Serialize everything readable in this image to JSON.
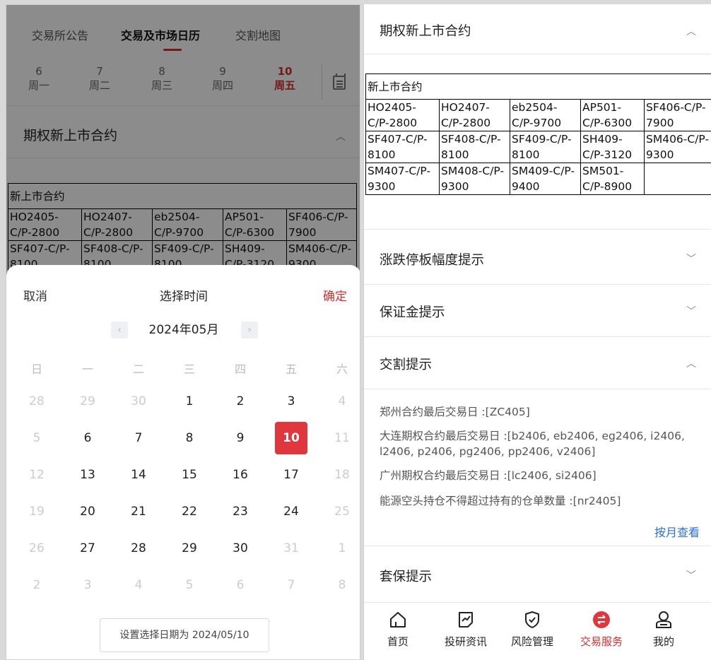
{
  "left": {
    "tabs": [
      "交易所公告",
      "交易及市场日历",
      "交割地图"
    ],
    "active_tab_index": 1,
    "days": [
      {
        "num": "6",
        "week": "周一"
      },
      {
        "num": "7",
        "week": "周二"
      },
      {
        "num": "8",
        "week": "周三"
      },
      {
        "num": "9",
        "week": "周四"
      },
      {
        "num": "10",
        "week": "周五"
      }
    ],
    "active_day_index": 4,
    "section_title": "期权新上市合约",
    "table": {
      "header": "新上市合约",
      "rows": [
        [
          "HO2405-C/P-2800",
          "HO2407-C/P-2800",
          "eb2504-C/P-9700",
          "AP501-C/P-6300",
          "SF406-C/P-7900"
        ],
        [
          "SF407-C/P-8100",
          "SF408-C/P-8100",
          "SF409-C/P-8100",
          "SH409-C/P-3120",
          "SM406-C/P-9300"
        ]
      ]
    }
  },
  "picker": {
    "cancel": "取消",
    "title": "选择时间",
    "confirm": "确定",
    "month": "2024年05月",
    "prev_icon": "‹",
    "next_icon": "›",
    "weekdays": [
      "日",
      "一",
      "二",
      "三",
      "四",
      "五",
      "六"
    ],
    "weeks": [
      [
        {
          "d": "28",
          "m": true
        },
        {
          "d": "29",
          "m": true
        },
        {
          "d": "30",
          "m": true
        },
        {
          "d": "1"
        },
        {
          "d": "2"
        },
        {
          "d": "3"
        },
        {
          "d": "4",
          "m": true
        }
      ],
      [
        {
          "d": "5",
          "m": true
        },
        {
          "d": "6"
        },
        {
          "d": "7"
        },
        {
          "d": "8"
        },
        {
          "d": "9"
        },
        {
          "d": "10",
          "s": true
        },
        {
          "d": "11",
          "m": true
        }
      ],
      [
        {
          "d": "12",
          "m": true
        },
        {
          "d": "13"
        },
        {
          "d": "14"
        },
        {
          "d": "15"
        },
        {
          "d": "16"
        },
        {
          "d": "17"
        },
        {
          "d": "18",
          "m": true
        }
      ],
      [
        {
          "d": "19",
          "m": true
        },
        {
          "d": "20"
        },
        {
          "d": "21"
        },
        {
          "d": "22"
        },
        {
          "d": "23"
        },
        {
          "d": "24"
        },
        {
          "d": "25",
          "m": true
        }
      ],
      [
        {
          "d": "26",
          "m": true
        },
        {
          "d": "27"
        },
        {
          "d": "28"
        },
        {
          "d": "29"
        },
        {
          "d": "30"
        },
        {
          "d": "31",
          "m": true
        },
        {
          "d": "1",
          "m": true
        }
      ],
      [
        {
          "d": "2",
          "m": true
        },
        {
          "d": "3",
          "m": true
        },
        {
          "d": "4",
          "m": true
        },
        {
          "d": "5",
          "m": true
        },
        {
          "d": "6",
          "m": true
        },
        {
          "d": "7",
          "m": true
        },
        {
          "d": "8",
          "m": true
        }
      ]
    ],
    "set_button": "设置选择日期为 2024/05/10"
  },
  "right": {
    "section1_title": "期权新上市合约",
    "table": {
      "header": "新上市合约",
      "rows": [
        [
          "HO2405-C/P-2800",
          "HO2407-C/P-2800",
          "eb2504-C/P-9700",
          "AP501-C/P-6300",
          "SF406-C/P-7900"
        ],
        [
          "SF407-C/P-8100",
          "SF408-C/P-8100",
          "SF409-C/P-8100",
          "SH409-C/P-3120",
          "SM406-C/P-9300"
        ],
        [
          "SM407-C/P-9300",
          "SM408-C/P-9300",
          "SM409-C/P-9400",
          "SM501-C/P-8900",
          ""
        ]
      ]
    },
    "section2_title": "涨跌停板幅度提示",
    "section3_title": "保证金提示",
    "section4_title": "交割提示",
    "notices": [
      "郑州合约最后交易日 :[ZC405]",
      "大连期权合约最后交易日 :[b2406, eb2406, eg2406, i2406, l2406, p2406, pg2406, pp2406, v2406]",
      "广州期权合约最后交易日 :[lc2406, si2406]",
      "能源空头持仓不得超过持有的仓单数量 :[nr2405]"
    ],
    "by_month": "按月查看",
    "section5_title": "套保提示",
    "tabbar": [
      "首页",
      "投研资讯",
      "风险管理",
      "交易服务",
      "我的"
    ],
    "active_tab_index": 3,
    "accent": "#d32f2f"
  }
}
